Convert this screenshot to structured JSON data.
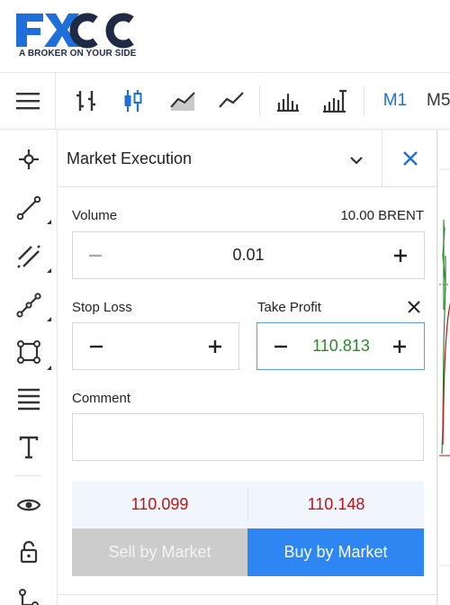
{
  "brand": {
    "tagline": "A BROKER ON YOUR SIDE",
    "colors": {
      "primary": "#1e6fd9",
      "dark": "#1f2a44"
    }
  },
  "toolbar": {
    "menu_icon": "hamburger-icon",
    "chart_types": [
      "bar-chart-icon",
      "candlestick-chart-icon",
      "area-chart-icon",
      "line-chart-icon"
    ],
    "indicators": [
      "volume-indicator-icon",
      "indicators-icon"
    ],
    "timeframes": [
      "M1",
      "M5"
    ]
  },
  "sidebar": {
    "tools": [
      "crosshair-icon",
      "trend-line-icon",
      "channel-icon",
      "polyline-icon",
      "shapes-icon",
      "fibonacci-icon",
      "text-icon",
      "eye-icon",
      "lock-icon",
      "tree-icon"
    ]
  },
  "order": {
    "mode": "Market Execution",
    "volume": {
      "label": "Volume",
      "info": "10.00 BRENT",
      "value": "0.01"
    },
    "stop_loss": {
      "label": "Stop Loss",
      "value": ""
    },
    "take_profit": {
      "label": "Take Profit",
      "value": "110.813"
    },
    "comment": {
      "label": "Comment",
      "value": ""
    },
    "bid": "110.099",
    "ask": "110.148",
    "sell_label": "Sell by Market",
    "buy_label": "Buy by Market",
    "colors": {
      "buy": "#2e86f2",
      "sell_disabled": "#cccccc",
      "price": "#c21212",
      "take_profit": "#2a8a2a"
    }
  }
}
